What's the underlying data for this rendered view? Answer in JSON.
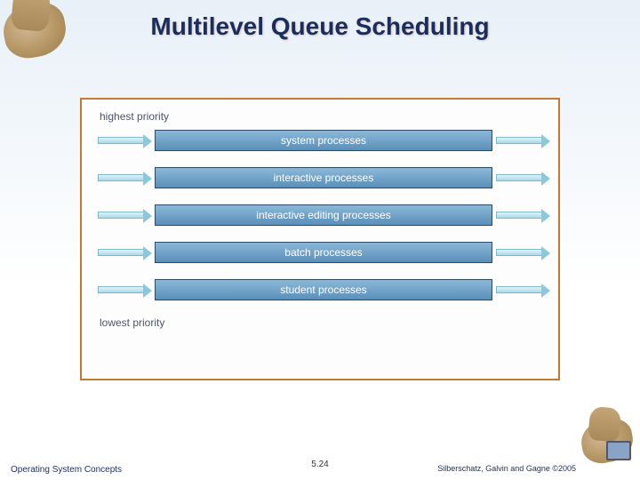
{
  "title": "Multilevel Queue Scheduling",
  "priority_top": "highest priority",
  "priority_bottom": "lowest priority",
  "queues": [
    "system processes",
    "interactive processes",
    "interactive editing processes",
    "batch processes",
    "student processes"
  ],
  "footer": {
    "left": "Operating System Concepts",
    "center": "5.24",
    "right": "Silberschatz, Galvin and Gagne ©2005"
  }
}
